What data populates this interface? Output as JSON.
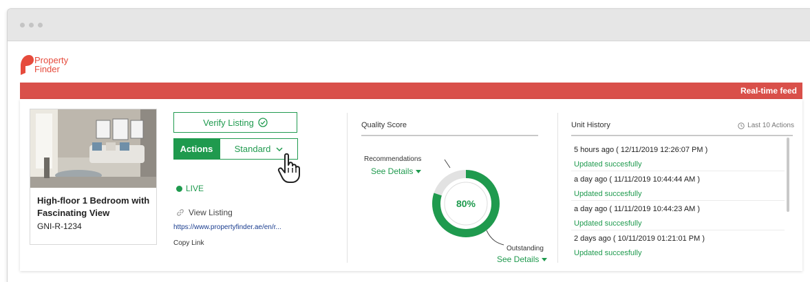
{
  "brand": {
    "name_line1": "Property",
    "name_line2": "Finder",
    "color": "#e64b3c"
  },
  "feed_bar": {
    "label": "Real-time feed",
    "color": "#d9504a"
  },
  "listing": {
    "title": "High-floor 1 Bedroom with Fascinating View",
    "reference": "GNI-R-1234",
    "photo": "living-room-photo"
  },
  "actions": {
    "verify_label": "Verify Listing",
    "verify_icon": "check-circle-icon",
    "actions_label": "Actions",
    "standard_label": "Standard",
    "status": "LIVE",
    "view_listing_label": "View Listing",
    "listing_url": "https://www.propertyfinder.ae/en/r...",
    "copy_link_label": "Copy Link",
    "accent_color": "#1f9a4e"
  },
  "quality_score": {
    "title": "Quality Score",
    "score_percent": 80,
    "score_label": "80%",
    "recommendations_label": "Recommendations",
    "outstanding_label": "Outstanding",
    "see_details_label": "See Details"
  },
  "unit_history": {
    "title": "Unit History",
    "filter_label": "Last 10 Actions",
    "items": [
      {
        "time": "5 hours ago ( 12/11/2019 12:26:07 PM )",
        "status": "Updated succesfully"
      },
      {
        "time": "a day ago ( 11/11/2019 10:44:44 AM )",
        "status": "Updated succesfully"
      },
      {
        "time": "a day ago ( 11/11/2019 10:44:23 AM )",
        "status": "Updated succesfully"
      },
      {
        "time": "2 days ago ( 10/11/2019 01:21:01 PM )",
        "status": "Updated succesfully"
      }
    ]
  }
}
